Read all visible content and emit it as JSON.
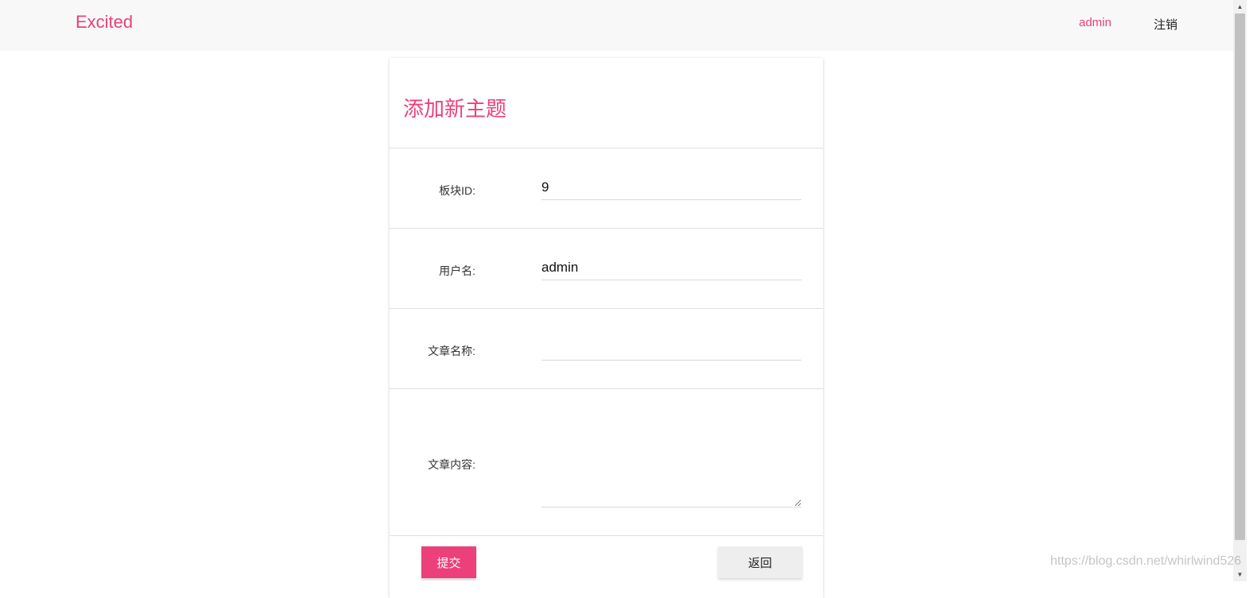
{
  "navbar": {
    "brand": "Excited",
    "user": "admin",
    "logout": "注销",
    "accent_color": "#ec407a"
  },
  "form": {
    "title": "添加新主题",
    "fields": {
      "board_id": {
        "label": "板块ID:",
        "value": "9"
      },
      "username": {
        "label": "用户名:",
        "value": "admin"
      },
      "article_title": {
        "label": "文章名称:",
        "value": ""
      },
      "article_content": {
        "label": "文章内容:",
        "value": ""
      }
    },
    "submit_label": "提交",
    "back_label": "返回"
  },
  "scrollbar": {
    "up_icon": "chevron-up-icon",
    "down_icon": "chevron-down-icon"
  },
  "watermark": "https://blog.csdn.net/whirlwind526"
}
